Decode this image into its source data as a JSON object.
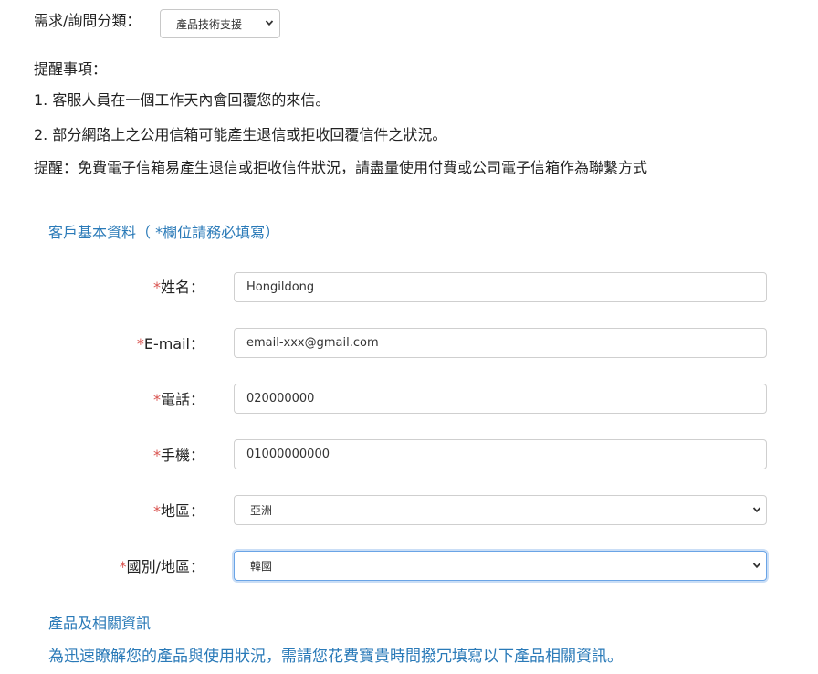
{
  "category": {
    "label": "需求/詢問分類：",
    "selected": "產品技術支援"
  },
  "notice": {
    "title": "提醒事項：",
    "items": [
      "1. 客服人員在一個工作天內會回覆您的來信。",
      "2. 部分網路上之公用信箱可能產生退信或拒收回覆信件之狀況。"
    ],
    "tip": "提醒：免費電子信箱易產生退信或拒收信件狀況，請盡量使用付費或公司電子信箱作為聯繫方式"
  },
  "customer_section": {
    "title": "客戶基本資料（ *欄位請務必填寫）"
  },
  "form": {
    "required_mark": "*",
    "name": {
      "label": "姓名：",
      "value": "Hongildong"
    },
    "email": {
      "label": "E-mail：",
      "value": "email-xxx@gmail.com"
    },
    "phone": {
      "label": "電話：",
      "value": "020000000"
    },
    "mobile": {
      "label": "手機：",
      "value": "01000000000"
    },
    "region": {
      "label": "地區：",
      "selected": "亞洲"
    },
    "country": {
      "label": "國別/地區：",
      "selected": "韓國"
    }
  },
  "product_section": {
    "title": "產品及相關資訊",
    "description": "為迅速瞭解您的產品與使用狀況，需請您花費寶貴時間撥冗填寫以下產品相關資訊。"
  },
  "icons": {
    "dropdown": "chevron-down-icon"
  },
  "colors": {
    "link_blue": "#2a7ab8",
    "required_red": "#d9534f",
    "focus_border": "#6aa4e6"
  }
}
